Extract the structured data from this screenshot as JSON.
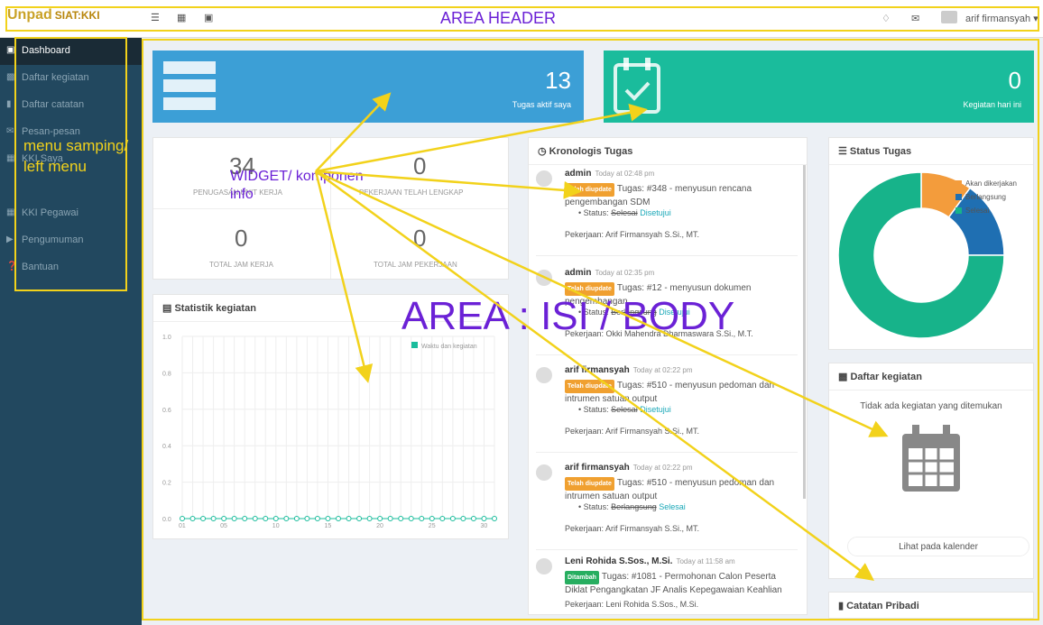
{
  "header": {
    "logo_text": "Unpad",
    "logo_sub": "SIAT:KKI",
    "area_label": "AREA HEADER",
    "user_name": "arif firmansyah"
  },
  "sidebar": {
    "items": [
      {
        "label": "Dashboard",
        "icon": "monitor-icon"
      },
      {
        "label": "Daftar kegiatan",
        "icon": "calendar-icon"
      },
      {
        "label": "Daftar catatan",
        "icon": "book-icon"
      },
      {
        "label": "Pesan-pesan",
        "icon": "envelope-icon"
      },
      {
        "label": "KKI Saya",
        "icon": "grid-icon"
      },
      {
        "label": "KKI Pegawai",
        "icon": "grid-icon"
      },
      {
        "label": "Pengumuman",
        "icon": "bullhorn-icon"
      },
      {
        "label": "Bantuan",
        "icon": "question-icon"
      }
    ]
  },
  "annotations": {
    "menu_label": "menu samping/ left menu",
    "widget_label": "WIDGET/ komponen info",
    "body_label": "AREA : ISI / BODY"
  },
  "tiles": {
    "tasks": {
      "value": "13",
      "caption": "Tugas aktif saya",
      "color": "#3c9fd6"
    },
    "activities": {
      "value": "0",
      "caption": "Kegiatan hari ini",
      "color": "#1abc9c"
    }
  },
  "stats": {
    "penugasan_value": "34",
    "penugasan_label": "PENUGASAN UNIT KERJA",
    "pekerjaan_value": "0",
    "pekerjaan_label": "PEKERJAAN TELAH LENGKAP",
    "jam_kerja_value": "0",
    "jam_kerja_label": "TOTAL JAM KERJA",
    "jam_pekerjaan_value": "0",
    "jam_pekerjaan_label": "TOTAL JAM PEKERJAAN"
  },
  "statistik": {
    "title": "Statistik kegiatan",
    "legend": "Waktu dan kegiatan"
  },
  "chart_data": {
    "type": "line",
    "title": "Statistik kegiatan",
    "xlabel": "",
    "ylabel": "",
    "ylim": [
      0.0,
      1.0
    ],
    "y_ticks": [
      "1.0",
      "0.8",
      "0.6",
      "0.4",
      "0.2",
      "0.0"
    ],
    "x_ticks": [
      "01",
      "05",
      "10",
      "15",
      "20",
      "25",
      "30"
    ],
    "series": [
      {
        "name": "Waktu dan kegiatan",
        "color": "#1abc9c",
        "x": [
          1,
          2,
          3,
          4,
          5,
          6,
          7,
          8,
          9,
          10,
          11,
          12,
          13,
          14,
          15,
          16,
          17,
          18,
          19,
          20,
          21,
          22,
          23,
          24,
          25,
          26,
          27,
          28,
          29,
          30,
          31
        ],
        "values": [
          0,
          0,
          0,
          0,
          0,
          0,
          0,
          0,
          0,
          0,
          0,
          0,
          0,
          0,
          0,
          0,
          0,
          0,
          0,
          0,
          0,
          0,
          0,
          0,
          0,
          0,
          0,
          0,
          0,
          0,
          0
        ]
      }
    ]
  },
  "kronologis": {
    "title": "Kronologis Tugas",
    "items": [
      {
        "name": "admin",
        "time": "Today at 02:48 pm",
        "badge": "Telah diupdate",
        "badge_color": "#f0a030",
        "text": "Tugas: #348 - menyusun rencana pengembangan SDM",
        "status_label": "Status:",
        "status_old": "Selesai",
        "status_new": "Disetujui",
        "pekerjaan": "Pekerjaan: Arif Firmansyah S.Si., MT."
      },
      {
        "name": "admin",
        "time": "Today at 02:35 pm",
        "badge": "Telah diupdate",
        "badge_color": "#f0a030",
        "text": "Tugas: #12 - menyusun dokumen pengembangan",
        "status_label": "Status:",
        "status_old": "Berlangsung",
        "status_new": "Disetujui",
        "pekerjaan": "Pekerjaan: Okki Mahendra Dharmaswara S.Si., M.T."
      },
      {
        "name": "arif firmansyah",
        "time": "Today at 02:22 pm",
        "badge": "Telah diupdate",
        "badge_color": "#f0a030",
        "text": "Tugas: #510 - menyusun pedoman dan intrumen satuan output",
        "status_label": "Status:",
        "status_old": "Selesai",
        "status_new": "Disetujui",
        "pekerjaan": "Pekerjaan: Arif Firmansyah S.Si., MT."
      },
      {
        "name": "arif firmansyah",
        "time": "Today at 02:22 pm",
        "badge": "Telah diupdate",
        "badge_color": "#f0a030",
        "text": "Tugas: #510 - menyusun pedoman dan intrumen satuan output",
        "status_label": "Status:",
        "status_old": "Berlangsung",
        "status_new": "Selesai",
        "pekerjaan": "Pekerjaan: Arif Firmansyah S.Si., MT."
      },
      {
        "name": "Leni Rohida S.Sos., M.Si.",
        "time": "Today at 11:58 am",
        "badge": "Ditambah",
        "badge_color": "#27ae60",
        "text": "Tugas: #1081 - Permohonan Calon Peserta Diklat Pengangkatan JF Analis Kepegawaian Keahlian",
        "status_label": "",
        "status_old": "",
        "status_new": "",
        "pekerjaan": "Pekerjaan: Leni Rohida S.Sos., M.Si."
      }
    ]
  },
  "status_tugas": {
    "title": "Status Tugas",
    "legend": [
      {
        "label": "Akan dikerjakan",
        "color": "#f39c3c",
        "share": 0.1
      },
      {
        "label": "Berlangsung",
        "color": "#1f6fb2",
        "share": 0.15
      },
      {
        "label": "Selesai",
        "color": "#17b38a",
        "share": 0.75
      }
    ]
  },
  "daftar_kegiatan": {
    "title": "Daftar kegiatan",
    "empty_text": "Tidak ada kegiatan yang ditemukan",
    "button": "Lihat pada kalender"
  },
  "catatan": {
    "title": "Catatan Pribadi"
  }
}
